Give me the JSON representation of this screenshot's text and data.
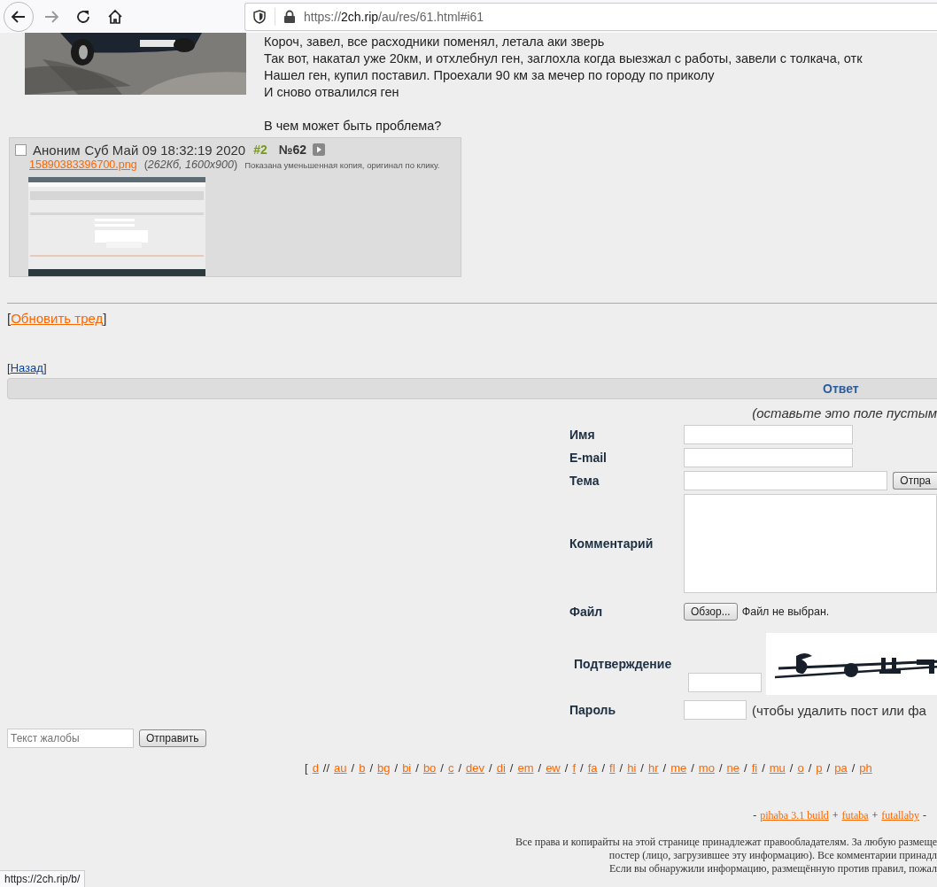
{
  "browser": {
    "forward_disabled": true,
    "url": {
      "scheme": "https://",
      "host": "2ch.rip",
      "path": "/au/res/61.html#i61"
    }
  },
  "op_post": {
    "paragraphs": [
      [
        "Короч, завел, все расходники поменял, летала аки зверь",
        "Так вот, накатал уже 20км, и отхлебнул ген, заглохла когда выезжал с работы, завели с толкача, отк",
        "Нашел ген, купил поставил. Проехали 90 км за мечер по городу по приколу",
        "И сново отвалился ген"
      ],
      [
        "В чем может быть проблема?"
      ]
    ]
  },
  "reply": {
    "checked": false,
    "name": "Аноним",
    "date": "Суб Май 09 18:32:19 2020",
    "index": "#2",
    "number": "№62",
    "file_link": "15890383396700.png",
    "file_info": "(*262Кб, 1600x900*)",
    "thumb_note": "Показана уменьшенная копия, оригинал по клику."
  },
  "refresh": {
    "open": "[",
    "link": "Обновить тред",
    "close": "]"
  },
  "back": {
    "open": "[",
    "link": "Назад",
    "close": "]"
  },
  "reply_form": {
    "title": "Ответ",
    "hint": "(оставьте это поле пустым",
    "fields": [
      {
        "kind": "text",
        "label": "Имя"
      },
      {
        "kind": "text",
        "label": "E-mail"
      },
      {
        "kind": "subject",
        "label": "Тема",
        "button": "Отпра"
      },
      {
        "kind": "textarea",
        "label": "Комментарий"
      },
      {
        "kind": "file",
        "label": "Файл",
        "button": "Обзор...",
        "status": "Файл не выбран."
      },
      {
        "kind": "captcha",
        "label": "Подтверждение"
      },
      {
        "kind": "password",
        "label": "Пароль",
        "note": "(чтобы удалить пост или фа"
      }
    ]
  },
  "complaint": {
    "placeholder": "Текст жалобы",
    "button": "Отправить"
  },
  "board_nav": [
    {
      "kind": "sep",
      "text": "["
    },
    {
      "kind": "link",
      "text": "d"
    },
    {
      "kind": "sep",
      "text": "//"
    },
    {
      "kind": "link",
      "text": "au"
    },
    {
      "kind": "sep",
      "text": "/"
    },
    {
      "kind": "link",
      "text": "b"
    },
    {
      "kind": "sep",
      "text": "/"
    },
    {
      "kind": "link",
      "text": "bg"
    },
    {
      "kind": "sep",
      "text": "/"
    },
    {
      "kind": "link",
      "text": "bi"
    },
    {
      "kind": "sep",
      "text": "/"
    },
    {
      "kind": "link",
      "text": "bo"
    },
    {
      "kind": "sep",
      "text": "/"
    },
    {
      "kind": "link",
      "text": "c"
    },
    {
      "kind": "sep",
      "text": "/"
    },
    {
      "kind": "link",
      "text": "dev"
    },
    {
      "kind": "sep",
      "text": "/"
    },
    {
      "kind": "link",
      "text": "di"
    },
    {
      "kind": "sep",
      "text": "/"
    },
    {
      "kind": "link",
      "text": "em"
    },
    {
      "kind": "sep",
      "text": "/"
    },
    {
      "kind": "link",
      "text": "ew"
    },
    {
      "kind": "sep",
      "text": "/"
    },
    {
      "kind": "link",
      "text": "f"
    },
    {
      "kind": "sep",
      "text": "/"
    },
    {
      "kind": "link",
      "text": "fa"
    },
    {
      "kind": "sep",
      "text": "/"
    },
    {
      "kind": "link",
      "text": "fl"
    },
    {
      "kind": "sep",
      "text": "/"
    },
    {
      "kind": "link",
      "text": "hi"
    },
    {
      "kind": "sep",
      "text": "/"
    },
    {
      "kind": "link",
      "text": "hr"
    },
    {
      "kind": "sep",
      "text": "/"
    },
    {
      "kind": "link",
      "text": "me"
    },
    {
      "kind": "sep",
      "text": "/"
    },
    {
      "kind": "link",
      "text": "mo"
    },
    {
      "kind": "sep",
      "text": "/"
    },
    {
      "kind": "link",
      "text": "ne"
    },
    {
      "kind": "sep",
      "text": "/"
    },
    {
      "kind": "link",
      "text": "fi"
    },
    {
      "kind": "sep",
      "text": "/"
    },
    {
      "kind": "link",
      "text": "mu"
    },
    {
      "kind": "sep",
      "text": "/"
    },
    {
      "kind": "link",
      "text": "o"
    },
    {
      "kind": "sep",
      "text": "/"
    },
    {
      "kind": "link",
      "text": "p"
    },
    {
      "kind": "sep",
      "text": "/"
    },
    {
      "kind": "link",
      "text": "pa"
    },
    {
      "kind": "sep",
      "text": "/"
    },
    {
      "kind": "link",
      "text": "ph"
    }
  ],
  "credits": [
    {
      "kind": "sep",
      "text": "-"
    },
    {
      "kind": "link",
      "text": "pihaba 3.1 build"
    },
    {
      "kind": "sep",
      "text": "+"
    },
    {
      "kind": "link",
      "text": "futaba"
    },
    {
      "kind": "sep",
      "text": "+"
    },
    {
      "kind": "link",
      "text": "futallaby"
    },
    {
      "kind": "sep",
      "text": "-"
    }
  ],
  "disclaimer": [
    "Все права и копирайты на этой странице принадлежат правообладателям. За любую размеще",
    "постер (лицо, загрузившее эту информацию). Все комментарии принадл",
    "Если вы обнаружили информацию, размещённую против правил, пожал"
  ],
  "status_url": "https://2ch.rip/b/"
}
